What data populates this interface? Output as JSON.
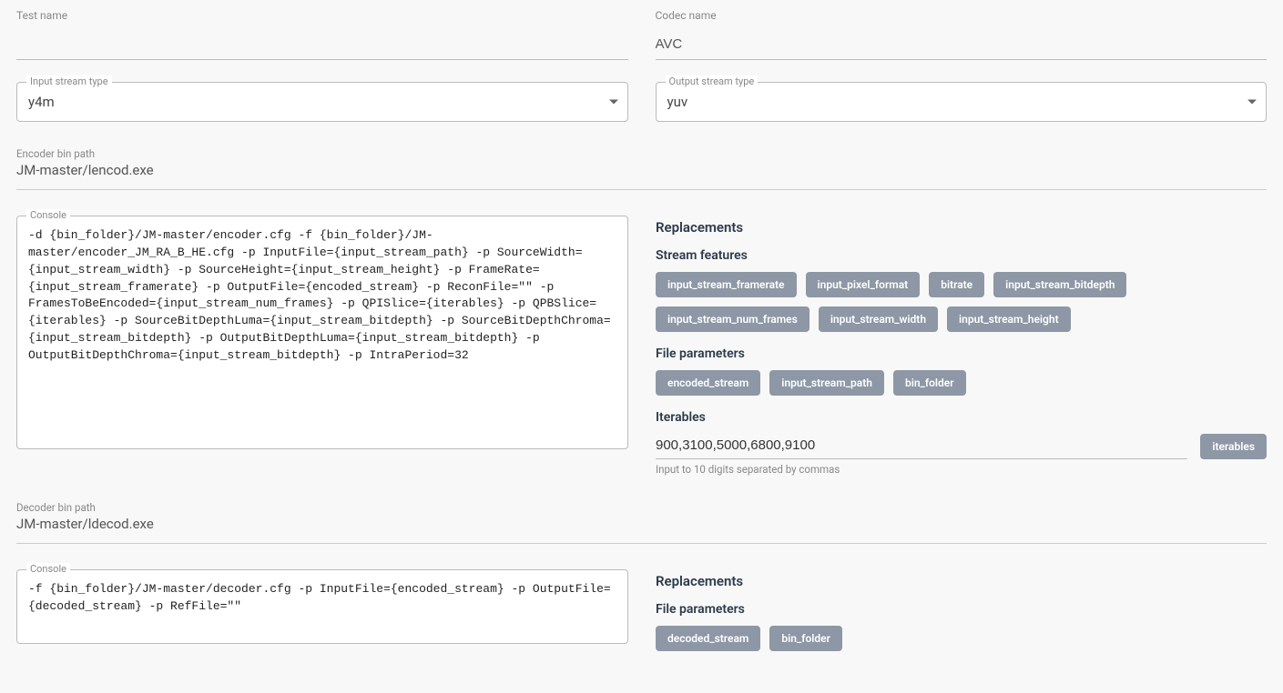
{
  "testName": {
    "label": "Test name",
    "value": ""
  },
  "codecName": {
    "label": "Codec name",
    "value": "AVC"
  },
  "inputStreamType": {
    "label": "Input stream type",
    "value": "y4m"
  },
  "outputStreamType": {
    "label": "Output stream type",
    "value": "yuv"
  },
  "encoderBinPath": {
    "label": "Encoder bin path",
    "value": "JM-master/lencod.exe"
  },
  "encoderConsole": {
    "label": "Console",
    "value": "-d {bin_folder}/JM-master/encoder.cfg -f {bin_folder}/JM-master/encoder_JM_RA_B_HE.cfg -p InputFile={input_stream_path} -p SourceWidth={input_stream_width} -p SourceHeight={input_stream_height} -p FrameRate={input_stream_framerate} -p OutputFile={encoded_stream} -p ReconFile=\"\" -p FramesToBeEncoded={input_stream_num_frames} -p QPISlice={iterables} -p QPBSlice={iterables} -p SourceBitDepthLuma={input_stream_bitdepth} -p SourceBitDepthChroma={input_stream_bitdepth} -p OutputBitDepthLuma={input_stream_bitdepth} -p OutputBitDepthChroma={input_stream_bitdepth} -p IntraPeriod=32"
  },
  "encoderReplacements": {
    "title": "Replacements",
    "streamFeaturesTitle": "Stream features",
    "streamFeatures": [
      "input_stream_framerate",
      "input_pixel_format",
      "bitrate",
      "input_stream_bitdepth",
      "input_stream_num_frames",
      "input_stream_width",
      "input_stream_height"
    ],
    "fileParamsTitle": "File parameters",
    "fileParams": [
      "encoded_stream",
      "input_stream_path",
      "bin_folder"
    ],
    "iterablesTitle": "Iterables",
    "iterablesValue": "900,3100,5000,6800,9100",
    "iterablesChip": "iterables",
    "iterablesHelper": "Input to 10 digits separated by commas"
  },
  "decoderBinPath": {
    "label": "Decoder bin path",
    "value": "JM-master/ldecod.exe"
  },
  "decoderConsole": {
    "label": "Console",
    "value": "-f {bin_folder}/JM-master/decoder.cfg -p InputFile={encoded_stream} -p OutputFile={decoded_stream} -p RefFile=\"\""
  },
  "decoderReplacements": {
    "title": "Replacements",
    "fileParamsTitle": "File parameters",
    "fileParams": [
      "decoded_stream",
      "bin_folder"
    ]
  }
}
